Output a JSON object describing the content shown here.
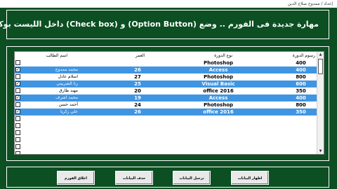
{
  "window": {
    "title": "إعداد / ممدوح صلاح الدين"
  },
  "heading": {
    "text": "مهارة جديدة فى الفورم .. وضع (Option Button) و (Check box) داخل الليست بوكس"
  },
  "list": {
    "columns": {
      "fee": "رسوم الدورة",
      "course": "نوع الدورة",
      "age": "العمر",
      "name": "اسم الطالب"
    },
    "rows": [
      {
        "checked": false,
        "selected": false,
        "fee": "400",
        "course": "Photoshop",
        "age": "",
        "name": ""
      },
      {
        "checked": true,
        "selected": true,
        "fee": "400",
        "course": "Access",
        "age": "26",
        "name": "محمد ممدوح"
      },
      {
        "checked": false,
        "selected": false,
        "fee": "800",
        "course": "Photoshop",
        "age": "27",
        "name": "اسلام عادل"
      },
      {
        "checked": true,
        "selected": true,
        "fee": "600",
        "course": "Visual Basic",
        "age": "25",
        "name": "رنا الشربيني"
      },
      {
        "checked": false,
        "selected": false,
        "fee": "350",
        "course": "office 2016",
        "age": "20",
        "name": "مهند طارق"
      },
      {
        "checked": true,
        "selected": true,
        "fee": "400",
        "course": "Access",
        "age": "19",
        "name": "محمد اشرف"
      },
      {
        "checked": false,
        "selected": false,
        "fee": "800",
        "course": "Photoshop",
        "age": "24",
        "name": "أحمد حسن"
      },
      {
        "checked": true,
        "selected": true,
        "fee": "350",
        "course": "office 2016",
        "age": "26",
        "name": "علي زكريا"
      }
    ],
    "empty_row_count": 6
  },
  "buttons": {
    "show": "اظهار البيانات",
    "transfer": "ترحيل البيانات",
    "delete": "حذف البيانات",
    "close": "اغلاق الفورم"
  },
  "colors": {
    "background": "#0c4f22",
    "selection": "#3f95e2"
  }
}
